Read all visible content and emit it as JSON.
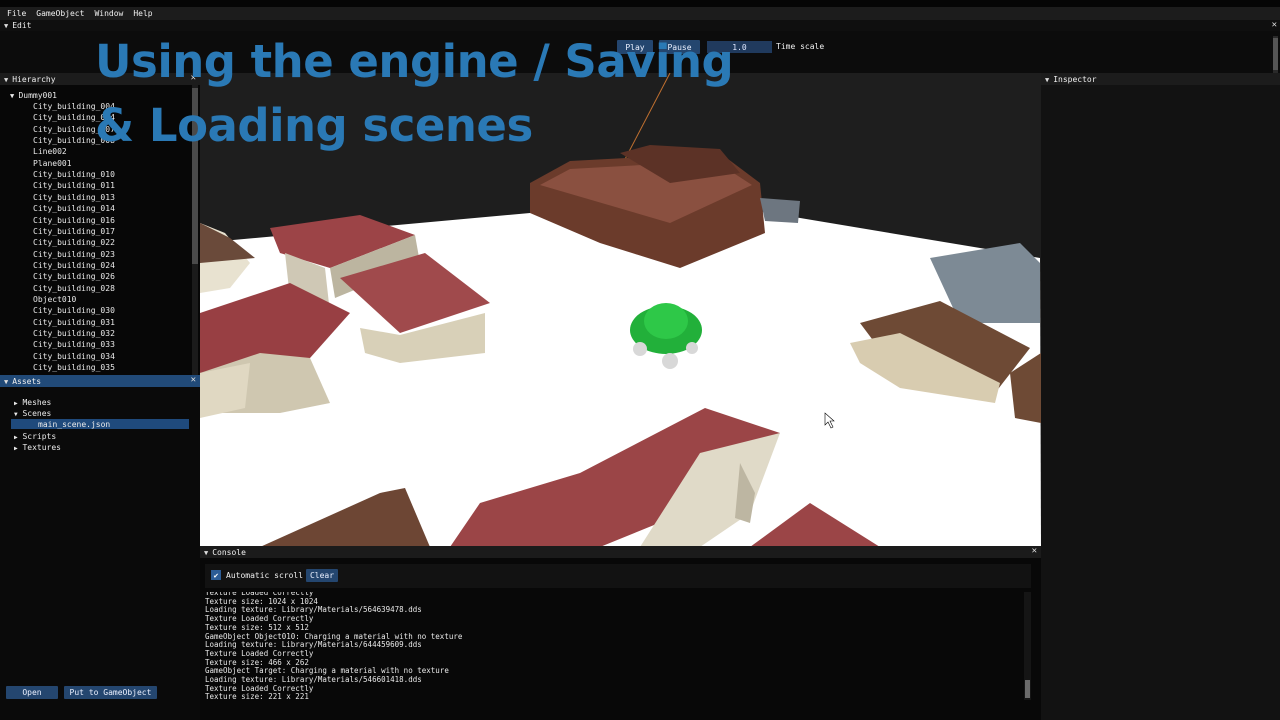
{
  "menubar": {
    "items": [
      "File",
      "GameObject",
      "Window",
      "Help"
    ]
  },
  "edit_panel": {
    "title": "Edit",
    "play_label": "Play",
    "pause_label": "Pause",
    "time_scale_value": "1.0",
    "time_scale_label": "Time scale"
  },
  "overlay": {
    "line1": "Using the engine / Saving",
    "line2": "& Loading scenes"
  },
  "hierarchy": {
    "title": "Hierarchy",
    "root": "Dummy001",
    "items": [
      "City_building_004",
      "City_building_004",
      "City_building_007",
      "City_building_008",
      "Line002",
      "Plane001",
      "City_building_010",
      "City_building_011",
      "City_building_013",
      "City_building_014",
      "City_building_016",
      "City_building_017",
      "City_building_022",
      "City_building_023",
      "City_building_024",
      "City_building_026",
      "City_building_028",
      "Object010",
      "City_building_030",
      "City_building_031",
      "City_building_032",
      "City_building_033",
      "City_building_034",
      "City_building_035"
    ]
  },
  "assets": {
    "title": "Assets",
    "folders": [
      "Meshes",
      "Scenes",
      "Scripts",
      "Textures"
    ],
    "selected_file": "main_scene.json",
    "open_label": "Open",
    "put_label": "Put to GameObject"
  },
  "inspector": {
    "title": "Inspector"
  },
  "console": {
    "title": "Console",
    "autoscroll_label": "Automatic scroll",
    "clear_label": "Clear",
    "lines": [
      "Texture Loaded Correctly",
      "Texture size: 1024 x 1024",
      "Loading texture: Library/Materials/564639478.dds",
      "Texture Loaded Correctly",
      "Texture size: 512 x 512",
      "GameObject Object010: Charging a material with no texture",
      "Loading texture: Library/Materials/644459609.dds",
      "Texture Loaded Correctly",
      "Texture size: 466 x 262",
      "GameObject Target: Charging a material with no texture",
      "Loading texture: Library/Materials/546601418.dds",
      "Texture Loaded Correctly",
      "Texture size: 221 x 221"
    ]
  },
  "colors": {
    "accent": "#24466f",
    "overlay_title": "#2a79b5",
    "roof": "#8e3d3f",
    "ground": "#ffffff",
    "car": "#22b03a"
  }
}
